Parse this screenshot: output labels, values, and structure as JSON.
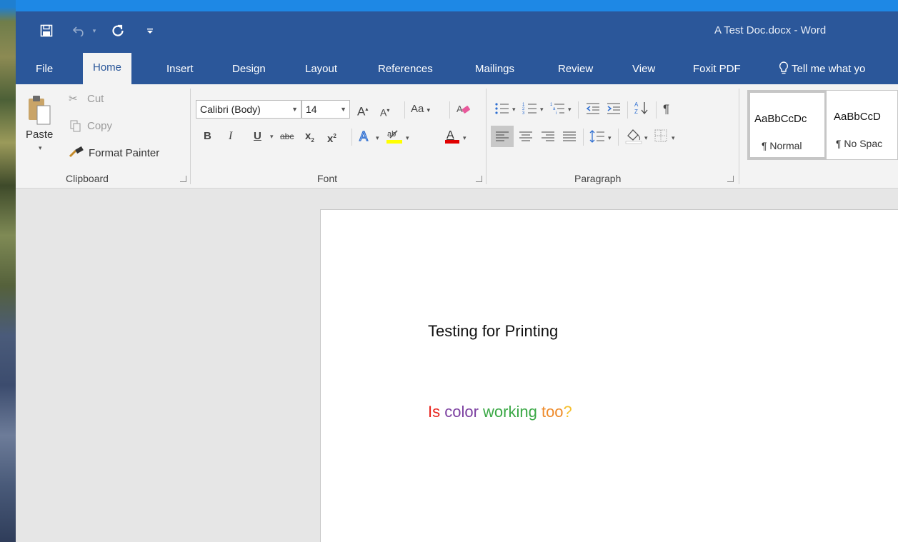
{
  "window": {
    "title": "A Test Doc.docx - Word"
  },
  "quick_access": {
    "save_icon": "save-icon",
    "undo_icon": "undo-icon",
    "redo_icon": "redo-icon",
    "customize_icon": "customize-qat-icon"
  },
  "tabs": {
    "file": "File",
    "home": "Home",
    "insert": "Insert",
    "design": "Design",
    "layout": "Layout",
    "references": "References",
    "mailings": "Mailings",
    "review": "Review",
    "view": "View",
    "foxit": "Foxit PDF",
    "tell_me": "Tell me what yo"
  },
  "clipboard": {
    "paste": "Paste",
    "cut": "Cut",
    "copy": "Copy",
    "format_painter": "Format Painter",
    "label": "Clipboard"
  },
  "font": {
    "family": "Calibri (Body)",
    "size": "14",
    "change_case": "Aa",
    "bold": "B",
    "italic": "I",
    "underline": "U",
    "strike": "abc",
    "subscript": "x",
    "superscript": "x",
    "label": "Font",
    "highlight_color": "#ffff00",
    "font_color": "#e00000"
  },
  "paragraph": {
    "sort": "A↓",
    "pilcrow": "¶",
    "label": "Paragraph"
  },
  "styles": {
    "items": [
      {
        "sample": "AaBbCcDc",
        "name": "¶ Normal"
      },
      {
        "sample": "AaBbCcD",
        "name": "¶ No Spac"
      }
    ]
  },
  "document": {
    "line1": "Testing for Printing",
    "line2": [
      {
        "text": "Is",
        "color": "#e8241d"
      },
      {
        "text": " color",
        "color": "#7b3fa0"
      },
      {
        "text": " working",
        "color": "#3aa845"
      },
      {
        "text": " too",
        "color": "#ee8a2a"
      },
      {
        "text": "?",
        "color": "#f5c030"
      }
    ]
  }
}
